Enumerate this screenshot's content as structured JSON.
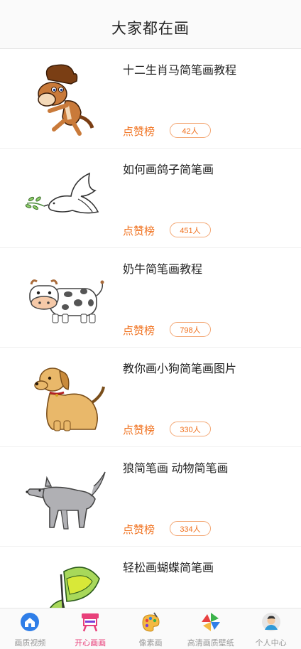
{
  "header": {
    "title": "大家都在画"
  },
  "items": [
    {
      "title": "十二生肖马简笔画教程",
      "rank_label": "点赞榜",
      "count": "42人",
      "image": "horse-drawing"
    },
    {
      "title": "如何画鸽子简笔画",
      "rank_label": "点赞榜",
      "count": "451人",
      "image": "dove-drawing"
    },
    {
      "title": "奶牛简笔画教程",
      "rank_label": "点赞榜",
      "count": "798人",
      "image": "cow-drawing"
    },
    {
      "title": "教你画小狗简笔画图片",
      "rank_label": "点赞榜",
      "count": "330人",
      "image": "dog-drawing"
    },
    {
      "title": "狼简笔画 动物简笔画",
      "rank_label": "点赞榜",
      "count": "334人",
      "image": "wolf-drawing"
    },
    {
      "title": "轻松画蝴蝶简笔画",
      "rank_label": "",
      "count": "",
      "image": "butterfly-drawing"
    }
  ],
  "tabs": [
    {
      "label": "画质视频",
      "icon": "home-icon",
      "active": false
    },
    {
      "label": "开心画画",
      "icon": "easel-icon",
      "active": true
    },
    {
      "label": "像素画",
      "icon": "palette-icon",
      "active": false
    },
    {
      "label": "高清画质壁纸",
      "icon": "pinwheel-icon",
      "active": false
    },
    {
      "label": "个人中心",
      "icon": "user-avatar-icon",
      "active": false
    }
  ],
  "colors": {
    "accent": "#f0711e",
    "active_tab": "#e8407a"
  }
}
